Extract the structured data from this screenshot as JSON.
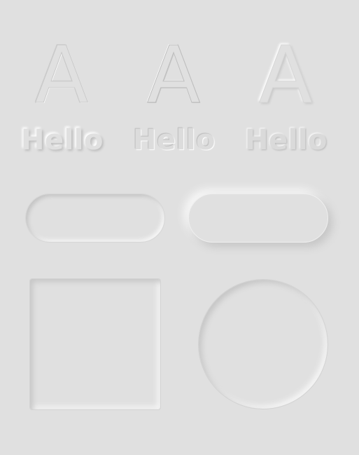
{
  "background_color": "#e0e0e0",
  "letters": [
    {
      "text": "A",
      "style": "debossed-outline"
    },
    {
      "text": "A",
      "style": "embossed-outline"
    },
    {
      "text": "A",
      "style": "raised-soft"
    }
  ],
  "words": [
    {
      "text": "Hello",
      "style": "raised-soft"
    },
    {
      "text": "Hello",
      "style": "inset"
    },
    {
      "text": "Hello",
      "style": "embossed"
    }
  ],
  "shapes": {
    "pill_left": "inset",
    "pill_right": "raised",
    "square": "inset",
    "circle": "inset"
  }
}
